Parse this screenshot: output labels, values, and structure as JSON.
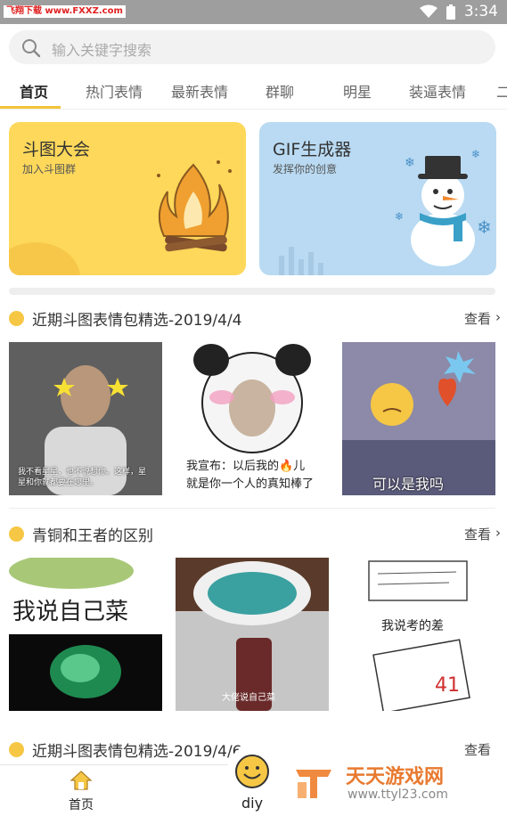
{
  "status_bar": {
    "watermark": "飞翔下载 www.FXXZ.com",
    "time": "3:34"
  },
  "search": {
    "placeholder": "输入关键字搜索"
  },
  "tabs": [
    "首页",
    "热门表情",
    "最新表情",
    "群聊",
    "明星",
    "装逼表情",
    "二"
  ],
  "banners": [
    {
      "title": "斗图大会",
      "subtitle": "加入斗图群"
    },
    {
      "title": "GIF生成器",
      "subtitle": "发挥你的创意"
    }
  ],
  "sections": [
    {
      "title": "近期斗图表情包精选-2019/4/4",
      "more": "查看",
      "captions": [
        "我不看星星，也不说想你。这样，星星和你就都要在您里。",
        "我宣布：以后我的🔥儿\n就是你一个人的真知棒了",
        "可以是我吗"
      ]
    },
    {
      "title": "青铜和王者的区别",
      "more": "查看",
      "captions": [
        "我说自己菜",
        "大佬说自己菜",
        "我说考的差"
      ]
    },
    {
      "title": "近期斗图表情包精选-2019/4/6",
      "more": "查看"
    }
  ],
  "bottom_nav": {
    "home": "首页",
    "diy": "diy"
  },
  "watermark_bottom": {
    "name": "天天游戏网",
    "url": "www.ttyl23.com"
  },
  "colors": {
    "accent": "#f3c43a",
    "banner_yellow": "#fdd85a",
    "banner_blue": "#b9daf2"
  }
}
